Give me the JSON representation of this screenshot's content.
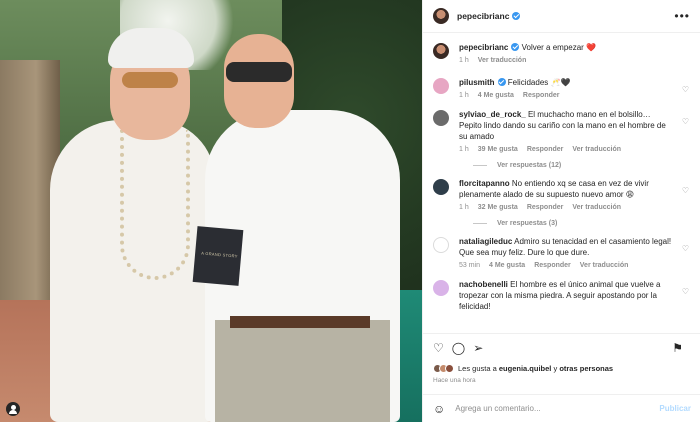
{
  "post": {
    "author": "pepecibrianc",
    "caption_author": "pepecibrianc",
    "caption": "Volver a empezar ❤️",
    "caption_time": "1 h",
    "caption_translate": "Ver traducción",
    "book_title": "A GRAND STORY"
  },
  "comments": [
    {
      "user": "pilusmith",
      "text": "Felicidades 🥂🖤",
      "time": "1 h",
      "likes": "4 Me gusta",
      "reply": "Responder",
      "verified": true,
      "avatar_color": "#e7a6c3"
    },
    {
      "user": "sylviao_de_rock_",
      "text": "El muchacho mano en el bolsillo… Pepito lindo dando su cariño con la mano en el hombre de su amado",
      "time": "1 h",
      "likes": "39 Me gusta",
      "reply": "Responder",
      "translate": "Ver traducción",
      "replies": "Ver respuestas (12)",
      "avatar_color": "#6b6b6b"
    },
    {
      "user": "florcitapanno",
      "text": "No entiendo xq se casa en vez de vivir plenamente alado de su supuesto nuevo amor 😩",
      "time": "1 h",
      "likes": "32 Me gusta",
      "reply": "Responder",
      "translate": "Ver traducción",
      "replies": "Ver respuestas (3)",
      "avatar_color": "#2f3e4a"
    },
    {
      "user": "nataliagileduc",
      "text": "Admiro su tenacidad en el casamiento legal! Que sea muy feliz. Dure lo que dure.",
      "time": "53 min",
      "likes": "4 Me gusta",
      "reply": "Responder",
      "translate": "Ver traducción",
      "avatar_color": "#ffffff"
    },
    {
      "user": "nachobenelli",
      "text": "El hombre es el único animal que vuelve a tropezar con la misma piedra. A seguir apostando por la felicidad!",
      "time": "",
      "avatar_color": "#d9b3e8"
    }
  ],
  "footer": {
    "likes_prefix": "Les gusta a ",
    "likes_user": "eugenia.quibel",
    "likes_suffix": " y ",
    "likes_others": "otras personas",
    "time": "Hace una hora",
    "comment_placeholder": "Agrega un comentario...",
    "publish": "Publicar"
  },
  "icons": [
    "more-icon",
    "heart-icon",
    "comment-icon",
    "share-icon",
    "bookmark-icon",
    "emoji-icon",
    "user-tag-icon",
    "verified-icon"
  ]
}
